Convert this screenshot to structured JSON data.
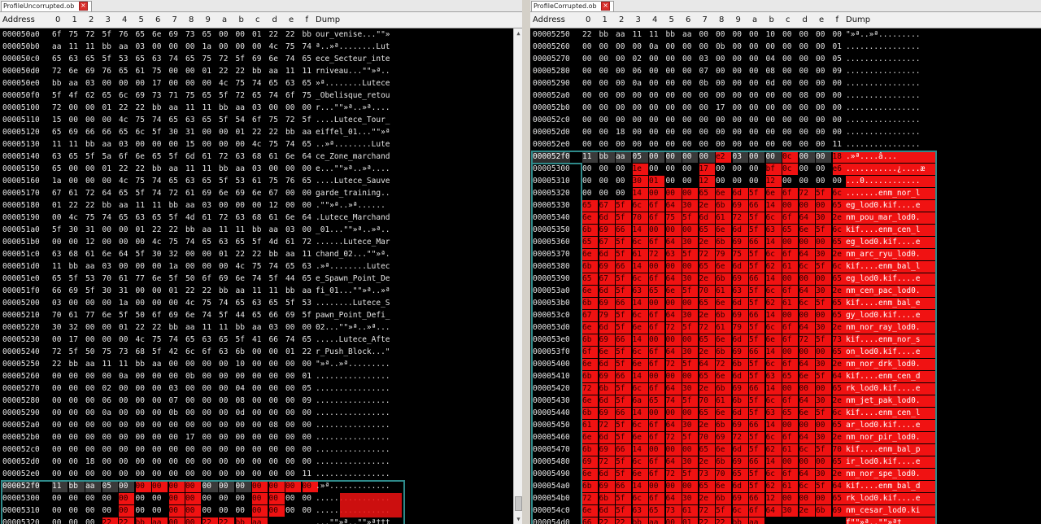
{
  "left": {
    "tab_label": "ProfileUncorrupted.ob",
    "close_glyph": "×",
    "header": {
      "address": "Address",
      "cols": [
        "0",
        "1",
        "2",
        "3",
        "4",
        "5",
        "6",
        "7",
        "8",
        "9",
        "a",
        "b",
        "c",
        "d",
        "e",
        "f"
      ],
      "dump": "Dump"
    },
    "rows": [
      {
        "addr": "000050a0",
        "hex": "6f 75 72 5f 76 65 6e 69 73 65 00 00 01 22 22 bb",
        "dump": "our_venise...\"\"»"
      },
      {
        "addr": "000050b0",
        "hex": "aa 11 11 bb aa 03 00 00 00 1a 00 00 00 4c 75 74",
        "dump": "ª..»ª........Lut"
      },
      {
        "addr": "000050c0",
        "hex": "65 63 65 5f 53 65 63 74 65 75 72 5f 69 6e 74 65",
        "dump": "ece_Secteur_inte"
      },
      {
        "addr": "000050d0",
        "hex": "72 6e 69 76 65 61 75 00 00 01 22 22 bb aa 11 11",
        "dump": "rniveau...\"\"»ª.."
      },
      {
        "addr": "000050e0",
        "hex": "bb aa 03 00 00 00 17 00 00 00 4c 75 74 65 63 65",
        "dump": "»ª........Lutece"
      },
      {
        "addr": "000050f0",
        "hex": "5f 4f 62 65 6c 69 73 71 75 65 5f 72 65 74 6f 75",
        "dump": "_Obelisque_retou"
      },
      {
        "addr": "00005100",
        "hex": "72 00 00 01 22 22 bb aa 11 11 bb aa 03 00 00 00",
        "dump": "r...\"\"»ª..»ª...."
      },
      {
        "addr": "00005110",
        "hex": "15 00 00 00 4c 75 74 65 63 65 5f 54 6f 75 72 5f",
        "dump": "....Lutece_Tour_"
      },
      {
        "addr": "00005120",
        "hex": "65 69 66 66 65 6c 5f 30 31 00 00 01 22 22 bb aa",
        "dump": "eiffel_01...\"\"»ª"
      },
      {
        "addr": "00005130",
        "hex": "11 11 bb aa 03 00 00 00 15 00 00 00 4c 75 74 65",
        "dump": "..»ª........Lute"
      },
      {
        "addr": "00005140",
        "hex": "63 65 5f 5a 6f 6e 65 5f 6d 61 72 63 68 61 6e 64",
        "dump": "ce_Zone_marchand"
      },
      {
        "addr": "00005150",
        "hex": "65 00 00 01 22 22 bb aa 11 11 bb aa 03 00 00 00",
        "dump": "e...\"\"»ª..»ª...."
      },
      {
        "addr": "00005160",
        "hex": "1a 00 00 00 4c 75 74 65 63 65 5f 53 61 75 76 65",
        "dump": "....Lutece_Sauve"
      },
      {
        "addr": "00005170",
        "hex": "67 61 72 64 65 5f 74 72 61 69 6e 69 6e 67 00 00",
        "dump": "garde_training.."
      },
      {
        "addr": "00005180",
        "hex": "01 22 22 bb aa 11 11 bb aa 03 00 00 00 12 00 00",
        "dump": ".\"\"»ª..»ª......"
      },
      {
        "addr": "00005190",
        "hex": "00 4c 75 74 65 63 65 5f 4d 61 72 63 68 61 6e 64",
        "dump": ".Lutece_Marchand"
      },
      {
        "addr": "000051a0",
        "hex": "5f 30 31 00 00 01 22 22 bb aa 11 11 bb aa 03 00",
        "dump": "_01...\"\"»ª..»ª.."
      },
      {
        "addr": "000051b0",
        "hex": "00 00 12 00 00 00 4c 75 74 65 63 65 5f 4d 61 72",
        "dump": "......Lutece_Mar"
      },
      {
        "addr": "000051c0",
        "hex": "63 68 61 6e 64 5f 30 32 00 00 01 22 22 bb aa 11",
        "dump": "chand_02...\"\"»ª."
      },
      {
        "addr": "000051d0",
        "hex": "11 bb aa 03 00 00 00 1a 00 00 00 4c 75 74 65 63",
        "dump": ".»ª........Lutec"
      },
      {
        "addr": "000051e0",
        "hex": "65 5f 53 70 61 77 6e 5f 50 6f 69 6e 74 5f 44 65",
        "dump": "e_Spawn_Point_De"
      },
      {
        "addr": "000051f0",
        "hex": "66 69 5f 30 31 00 00 01 22 22 bb aa 11 11 bb aa",
        "dump": "fi_01...\"\"»ª..»ª"
      },
      {
        "addr": "00005200",
        "hex": "03 00 00 00 1a 00 00 00 4c 75 74 65 63 65 5f 53",
        "dump": "........Lutece_S"
      },
      {
        "addr": "00005210",
        "hex": "70 61 77 6e 5f 50 6f 69 6e 74 5f 44 65 66 69 5f",
        "dump": "pawn_Point_Defi_"
      },
      {
        "addr": "00005220",
        "hex": "30 32 00 00 01 22 22 bb aa 11 11 bb aa 03 00 00",
        "dump": "02...\"\"»ª..»ª..."
      },
      {
        "addr": "00005230",
        "hex": "00 17 00 00 00 4c 75 74 65 63 65 5f 41 66 74 65",
        "dump": ".....Lutece_Afte"
      },
      {
        "addr": "00005240",
        "hex": "72 5f 50 75 73 68 5f 42 6c 6f 63 6b 00 00 01 22",
        "dump": "r_Push_Block...\""
      },
      {
        "addr": "00005250",
        "hex": "22 bb aa 11 11 bb aa 00 00 00 00 10 00 00 00 00",
        "dump": "\"»ª..»ª........."
      },
      {
        "addr": "00005260",
        "hex": "00 00 00 00 0a 00 00 00 0b 00 00 00 00 00 00 01",
        "dump": "................"
      },
      {
        "addr": "00005270",
        "hex": "00 00 00 02 00 00 00 03 00 00 00 04 00 00 00 05",
        "dump": "................"
      },
      {
        "addr": "00005280",
        "hex": "00 00 00 06 00 00 00 07 00 00 00 08 00 00 00 09",
        "dump": "................"
      },
      {
        "addr": "00005290",
        "hex": "00 00 00 0a 00 00 00 0b 00 00 00 0d 00 00 00 00",
        "dump": "................"
      },
      {
        "addr": "000052a0",
        "hex": "00 00 00 00 00 00 00 00 00 00 00 00 00 08 00 00",
        "dump": "................"
      },
      {
        "addr": "000052b0",
        "hex": "00 00 00 00 00 00 00 00 17 00 00 00 00 00 00 00",
        "dump": "................"
      },
      {
        "addr": "000052c0",
        "hex": "00 00 00 00 00 00 00 00 00 00 00 00 00 00 00 00",
        "dump": "................"
      },
      {
        "addr": "000052d0",
        "hex": "00 00 18 00 00 00 00 00 00 00 00 00 00 00 00 00",
        "dump": "................"
      },
      {
        "addr": "000052e0",
        "hex": "00 00 00 00 00 00 00 00 00 00 00 00 00 00 00 11",
        "dump": "................"
      },
      {
        "addr": "000052f0",
        "hex": "11 bb aa 05 00 00 00 00 00 00 00 00 00 00 00 00",
        "dump": ".»ª.............",
        "selected": true
      },
      {
        "addr": "00005300",
        "hex": "00 00 00 00 00 00 00 00 00 00 00 00 00 00 00 00",
        "dump": "................"
      },
      {
        "addr": "00005310",
        "hex": "00 00 00 00 00 00 00 00 00 00 00 00 00 00 00 00",
        "dump": "................"
      },
      {
        "addr": "00005320",
        "hex": "00 00 00 22 22 bb aa 00 00 22 22 bb aa",
        "dump": "...\"\"»ª..\"\"»ª†††"
      }
    ],
    "red_cells": [
      [
        37,
        5
      ],
      [
        37,
        6
      ],
      [
        37,
        7
      ],
      [
        37,
        8
      ],
      [
        37,
        12
      ],
      [
        37,
        13
      ],
      [
        37,
        14
      ],
      [
        37,
        15
      ],
      [
        38,
        4
      ],
      [
        38,
        7
      ],
      [
        38,
        8
      ],
      [
        38,
        12
      ],
      [
        38,
        13
      ],
      [
        39,
        4
      ],
      [
        39,
        7
      ],
      [
        39,
        8
      ],
      [
        39,
        12
      ],
      [
        39,
        13
      ],
      [
        40,
        3
      ],
      [
        40,
        4
      ],
      [
        40,
        5
      ],
      [
        40,
        6
      ],
      [
        40,
        7
      ],
      [
        40,
        8
      ],
      [
        40,
        9
      ],
      [
        40,
        10
      ],
      [
        40,
        11
      ],
      [
        40,
        12
      ],
      [
        40,
        13
      ],
      [
        40,
        14
      ],
      [
        40,
        15
      ]
    ]
  },
  "right": {
    "tab_label": "ProfileCorrupted.ob",
    "close_glyph": "×",
    "header": {
      "address": "Address",
      "cols": [
        "0",
        "1",
        "2",
        "3",
        "4",
        "5",
        "6",
        "7",
        "8",
        "9",
        "a",
        "b",
        "c",
        "d",
        "e",
        "f"
      ],
      "dump": "Dump"
    },
    "rows": [
      {
        "addr": "00005250",
        "hex": "22 bb aa 11 11 bb aa 00 00 00 00 10 00 00 00 00",
        "dump": "\"»ª..»ª........."
      },
      {
        "addr": "00005260",
        "hex": "00 00 00 00 0a 00 00 00 0b 00 00 00 00 00 00 01",
        "dump": "................"
      },
      {
        "addr": "00005270",
        "hex": "00 00 00 02 00 00 00 03 00 00 00 04 00 00 00 05",
        "dump": "................"
      },
      {
        "addr": "00005280",
        "hex": "00 00 00 06 00 00 00 07 00 00 00 08 00 00 00 09",
        "dump": "................"
      },
      {
        "addr": "00005290",
        "hex": "00 00 00 0a 00 00 00 0b 00 00 00 0d 00 00 00 00",
        "dump": "................"
      },
      {
        "addr": "000052a0",
        "hex": "00 00 00 00 00 00 00 00 00 00 00 00 00 08 00 00",
        "dump": "................"
      },
      {
        "addr": "000052b0",
        "hex": "00 00 00 00 00 00 00 00 17 00 00 00 00 00 00 00",
        "dump": "................"
      },
      {
        "addr": "000052c0",
        "hex": "00 00 00 00 00 00 00 00 00 00 00 00 00 00 00 00",
        "dump": "................"
      },
      {
        "addr": "000052d0",
        "hex": "00 00 18 00 00 00 00 00 00 00 00 00 00 00 00 00",
        "dump": "................"
      },
      {
        "addr": "000052e0",
        "hex": "00 00 00 00 00 00 00 00 00 00 00 00 00 00 00 11",
        "dump": "................"
      },
      {
        "addr": "000052f0",
        "hex": "11 bb aa 05 00 00 00 00 e2 03 00 00 0c 00 00 18",
        "dump": ".»ª....â...",
        "selected": true
      },
      {
        "addr": "00005300",
        "hex": "00 00 00 1e 00 00 00 17 00 00 00 bf 0c 00 00 e6",
        "dump": "...........¿....æ"
      },
      {
        "addr": "00005310",
        "hex": "00 00 00 30 01 00 00 12 00 00 00 12 00 00 00 00",
        "dump": "...0............"
      },
      {
        "addr": "00005320",
        "hex": "00 00 00 14 00 00 00 65 6e 6d 5f 6e 6f 72 5f 6c",
        "dump": ".......enm_nor_l"
      },
      {
        "addr": "00005330",
        "hex": "65 67 5f 6c 6f 64 30 2e 6b 69 66 14 00 00 00 65",
        "dump": "eg_lod0.kif....e"
      },
      {
        "addr": "00005340",
        "hex": "6e 6d 5f 70 6f 75 5f 6d 61 72 5f 6c 6f 64 30 2e",
        "dump": "nm_pou_mar_lod0."
      },
      {
        "addr": "00005350",
        "hex": "6b 69 66 14 00 00 00 65 6e 6d 5f 63 65 6e 5f 6c",
        "dump": "kif....enm_cen_l"
      },
      {
        "addr": "00005360",
        "hex": "65 67 5f 6c 6f 64 30 2e 6b 69 66 14 00 00 00 65",
        "dump": "eg_lod0.kif....e"
      },
      {
        "addr": "00005370",
        "hex": "6e 6d 5f 61 72 63 5f 72 79 75 5f 6c 6f 64 30 2e",
        "dump": "nm_arc_ryu_lod0."
      },
      {
        "addr": "00005380",
        "hex": "6b 69 66 14 00 00 00 65 6e 6d 5f 62 61 6c 5f 6c",
        "dump": "kif....enm_bal_l"
      },
      {
        "addr": "00005390",
        "hex": "65 67 5f 6c 6f 64 30 2e 6b 69 66 14 00 00 00 65",
        "dump": "eg_lod0.kif....e"
      },
      {
        "addr": "000053a0",
        "hex": "6e 6d 5f 63 65 6e 5f 70 61 63 5f 6c 6f 64 30 2e",
        "dump": "nm_cen_pac_lod0."
      },
      {
        "addr": "000053b0",
        "hex": "6b 69 66 14 00 00 00 65 6e 6d 5f 62 61 6c 5f 65",
        "dump": "kif....enm_bal_e"
      },
      {
        "addr": "000053c0",
        "hex": "67 79 5f 6c 6f 64 30 2e 6b 69 66 14 00 00 00 65",
        "dump": "gy_lod0.kif....e"
      },
      {
        "addr": "000053d0",
        "hex": "6e 6d 5f 6e 6f 72 5f 72 61 79 5f 6c 6f 64 30 2e",
        "dump": "nm_nor_ray_lod0."
      },
      {
        "addr": "000053e0",
        "hex": "6b 69 66 14 00 00 00 65 6e 6d 5f 6e 6f 72 5f 73",
        "dump": "kif....enm_nor_s"
      },
      {
        "addr": "000053f0",
        "hex": "6f 6e 5f 6c 6f 64 30 2e 6b 69 66 14 00 00 00 65",
        "dump": "on_lod0.kif....e"
      },
      {
        "addr": "00005400",
        "hex": "6e 6d 5f 6e 6f 72 5f 64 72 6b 5f 6c 6f 64 30 2e",
        "dump": "nm_nor_drk_lod0."
      },
      {
        "addr": "00005410",
        "hex": "6b 69 66 14 00 00 00 65 6e 6d 5f 63 65 6e 5f 64",
        "dump": "kif....enm_cen_d"
      },
      {
        "addr": "00005420",
        "hex": "72 6b 5f 6c 6f 64 30 2e 6b 69 66 14 00 00 00 65",
        "dump": "rk_lod0.kif....e"
      },
      {
        "addr": "00005430",
        "hex": "6e 6d 5f 6a 65 74 5f 70 61 6b 5f 6c 6f 64 30 2e",
        "dump": "nm_jet_pak_lod0."
      },
      {
        "addr": "00005440",
        "hex": "6b 69 66 14 00 00 00 65 6e 6d 5f 63 65 6e 5f 6c",
        "dump": "kif....enm_cen_l"
      },
      {
        "addr": "00005450",
        "hex": "61 72 5f 6c 6f 64 30 2e 6b 69 66 14 00 00 00 65",
        "dump": "ar_lod0.kif....e"
      },
      {
        "addr": "00005460",
        "hex": "6e 6d 5f 6e 6f 72 5f 70 69 72 5f 6c 6f 64 30 2e",
        "dump": "nm_nor_pir_lod0."
      },
      {
        "addr": "00005470",
        "hex": "6b 69 66 14 00 00 00 65 6e 6d 5f 62 61 6c 5f 70",
        "dump": "kif....enm_bal_p"
      },
      {
        "addr": "00005480",
        "hex": "69 72 5f 6c 6f 64 30 2e 6b 69 66 14 00 00 00 65",
        "dump": "ir_lod0.kif....e"
      },
      {
        "addr": "00005490",
        "hex": "6e 6d 5f 6e 6f 72 5f 73 70 65 5f 6c 6f 64 30 2e",
        "dump": "nm_nor_spe_lod0."
      },
      {
        "addr": "000054a0",
        "hex": "6b 69 66 14 00 00 00 65 6e 6d 5f 62 61 6c 5f 64",
        "dump": "kif....enm_bal_d"
      },
      {
        "addr": "000054b0",
        "hex": "72 6b 5f 6c 6f 64 30 2e 6b 69 66 12 00 00 00 65",
        "dump": "rk_lod0.kif....e"
      },
      {
        "addr": "000054c0",
        "hex": "6e 6d 5f 63 65 73 61 72 5f 6c 6f 64 30 2e 6b 69",
        "dump": "nm_cesar_lod0.ki"
      },
      {
        "addr": "000054d0",
        "hex": "66 22 22 bb aa 00 01 22 22 bb aa",
        "dump": "f\"\"»ª..\"\"»ª†"
      }
    ],
    "red_cells": [
      [
        10,
        8
      ],
      [
        10,
        12
      ],
      [
        10,
        15
      ],
      [
        11,
        3
      ],
      [
        11,
        7
      ],
      [
        11,
        11
      ],
      [
        11,
        12
      ],
      [
        11,
        15
      ],
      [
        12,
        3
      ],
      [
        12,
        4
      ],
      [
        12,
        7
      ],
      [
        12,
        11
      ]
    ]
  }
}
